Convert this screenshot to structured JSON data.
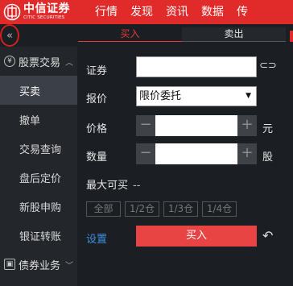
{
  "brand": {
    "name_cn": "中信证券",
    "name_en": "CITIC SECURITIES"
  },
  "nav": [
    "行情",
    "发现",
    "资讯",
    "数据",
    "传"
  ],
  "collapse_glyph": "«",
  "sidebar": {
    "group_stock": "股票交易",
    "items": [
      "买卖",
      "撤单",
      "交易查询",
      "盘后定价",
      "新股申购",
      "银证转账"
    ],
    "group_bond": "债券业务"
  },
  "tabs": {
    "buy": "买入",
    "sell": "卖出"
  },
  "form": {
    "security_label": "证券",
    "security_value": "",
    "quote_label": "报价",
    "quote_value": "限价委托",
    "price_label": "价格",
    "price_value": "",
    "price_unit": "元",
    "qty_label": "数量",
    "qty_value": "",
    "qty_unit": "股",
    "max_label": "最大可买",
    "max_value": "--",
    "qty_buttons": [
      "全部",
      "1/2仓",
      "1/3仓",
      "1/4仓"
    ],
    "settings_label": "设置",
    "submit_label": "买入"
  },
  "colors": {
    "brand_red": "#e12a2a",
    "active_tab": "#e13b3b",
    "link_blue": "#3d8fe0",
    "submit": "#e84444"
  }
}
